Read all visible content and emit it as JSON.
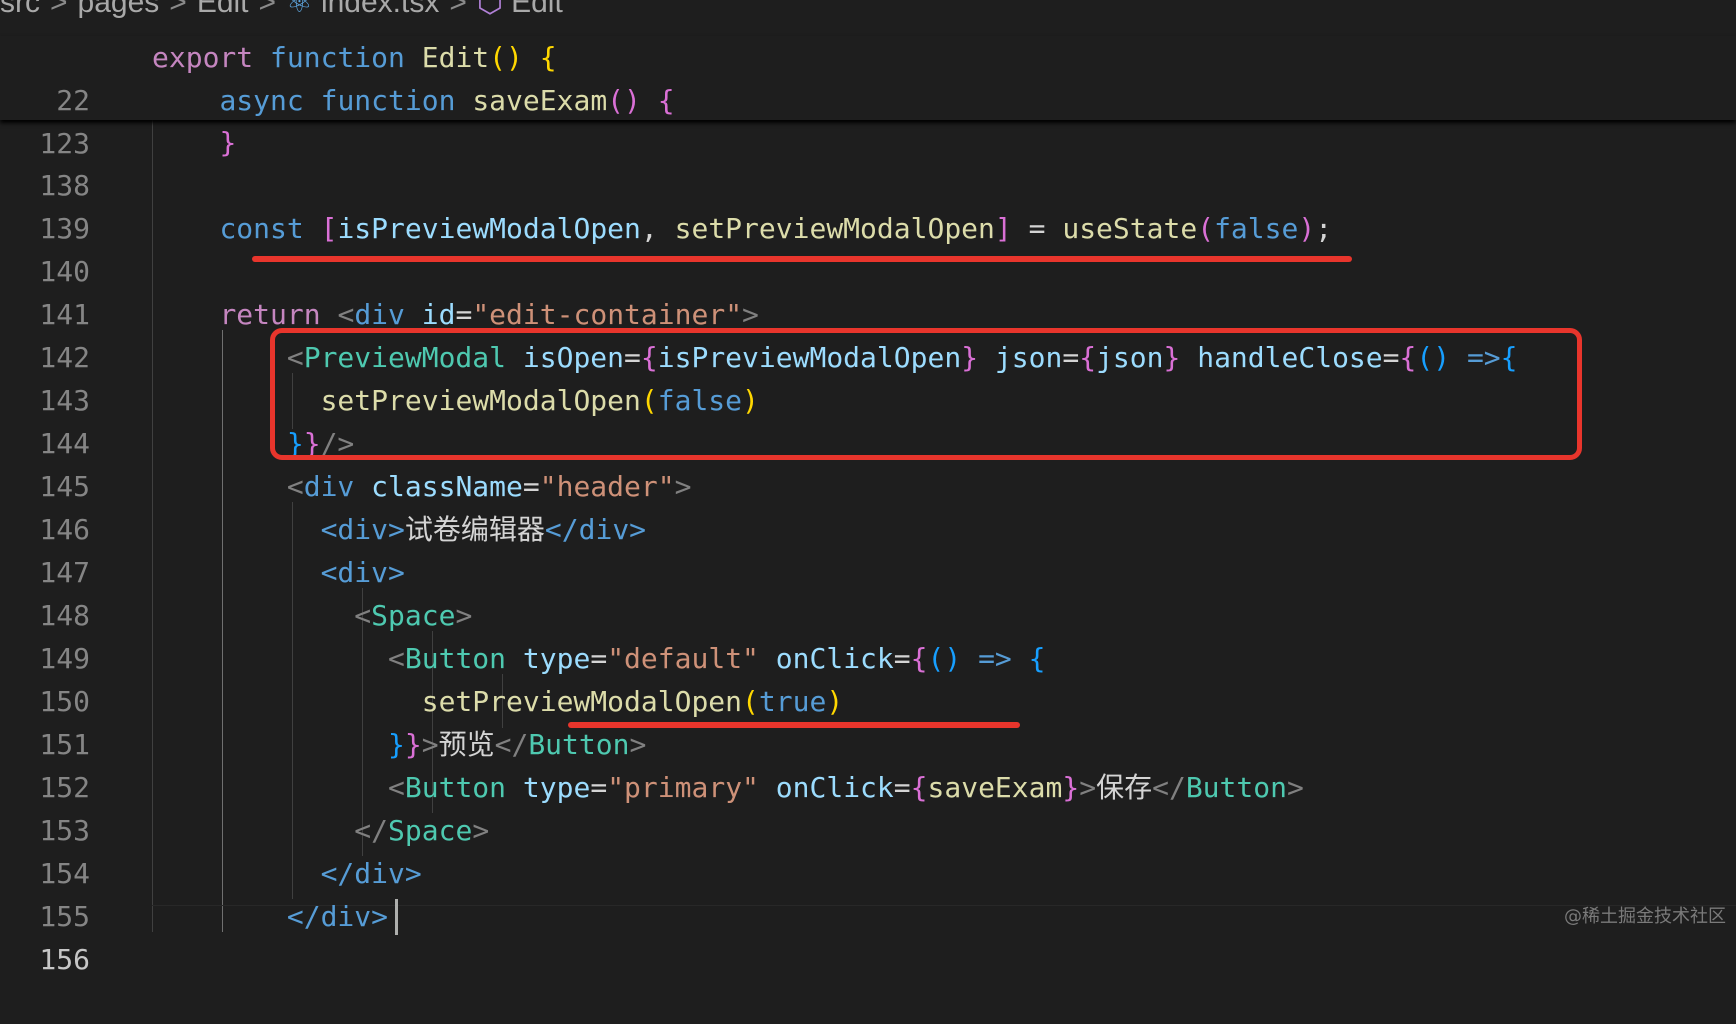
{
  "breadcrumb": {
    "items": [
      "src",
      "pages",
      "Edit",
      "index.tsx",
      "Edit"
    ],
    "separator": ">"
  },
  "editor": {
    "line_numbers": [
      "22",
      "123",
      "138",
      "139",
      "140",
      "141",
      "142",
      "143",
      "144",
      "145",
      "146",
      "147",
      "148",
      "149",
      "150",
      "151",
      "152",
      "153",
      "154",
      "155",
      "156"
    ],
    "lines": {
      "l22": {
        "kw1": "export",
        "kw2": "function",
        "name": "Edit",
        "paren": "()",
        "brace": "{"
      },
      "l123": {
        "kw1": "async",
        "kw2": "function",
        "name": "saveExam",
        "paren": "()",
        "brace": "{"
      },
      "l138": {
        "brace": "}"
      },
      "l140": {
        "kw": "const",
        "open": "[",
        "v1": "isPreviewModalOpen",
        "comma": ",",
        "v2": "setPreviewModalOpen",
        "close": "]",
        "eq": "=",
        "fn": "useState",
        "po": "(",
        "arg": "false",
        "pc": ")",
        "semi": ";"
      },
      "l142": {
        "kw": "return",
        "lt": "<",
        "tag": "div",
        "attr": "id",
        "eq": "=",
        "val": "\"edit-container\"",
        "gt": ">"
      },
      "l143": {
        "lt": "<",
        "tag": "PreviewModal",
        "a1": "isOpen",
        "eq1": "=",
        "b1o": "{",
        "v1": "isPreviewModalOpen",
        "b1c": "}",
        "a2": "json",
        "eq2": "=",
        "b2o": "{",
        "v2": "json",
        "b2c": "}",
        "a3": "handleClose",
        "eq3": "=",
        "b3o": "{",
        "par": "()",
        "arrow": "=>",
        "b4o": "{"
      },
      "l144": {
        "fn": "setPreviewModalOpen",
        "po": "(",
        "arg": "false",
        "pc": ")"
      },
      "l145": {
        "b4c": "}",
        "b3c": "}",
        "end": "/>"
      },
      "l146": {
        "lt": "<",
        "tag": "div",
        "attr": "className",
        "eq": "=",
        "val": "\"header\"",
        "gt": ">"
      },
      "l147": {
        "open": "<div>",
        "text": "试卷编辑器",
        "close": "</div>"
      },
      "l148": {
        "open": "<div>"
      },
      "l149": {
        "lt": "<",
        "tag": "Space",
        "gt": ">"
      },
      "l150": {
        "lt": "<",
        "tag": "Button",
        "a1": "type",
        "eq1": "=",
        "v1": "\"default\"",
        "a2": "onClick",
        "eq2": "=",
        "bo": "{",
        "par": "()",
        "arrow": "=>",
        "bo2": "{"
      },
      "l151": {
        "fn": "setPreviewModalOpen",
        "po": "(",
        "arg": "true",
        "pc": ")"
      },
      "l152": {
        "bc2": "}",
        "bc": "}",
        "gt": ">",
        "text": "预览",
        "close_lt": "</",
        "tag": "Button",
        "close_gt": ">"
      },
      "l153": {
        "lt": "<",
        "tag": "Button",
        "a1": "type",
        "eq1": "=",
        "v1": "\"primary\"",
        "a2": "onClick",
        "eq2": "=",
        "bo": "{",
        "v2": "saveExam",
        "bc": "}",
        "gt": ">",
        "text": "保存",
        "close_lt": "</",
        "tag2": "Button",
        "close_gt": ">"
      },
      "l154": {
        "lt": "</",
        "tag": "Space",
        "gt": ">"
      },
      "l155": {
        "close": "</div>"
      },
      "l156": {
        "close": "</div>"
      }
    }
  },
  "watermark": "@稀土掘金技术社区",
  "colors": {
    "annotation": "#e8352c",
    "background": "#1e1e1e"
  }
}
